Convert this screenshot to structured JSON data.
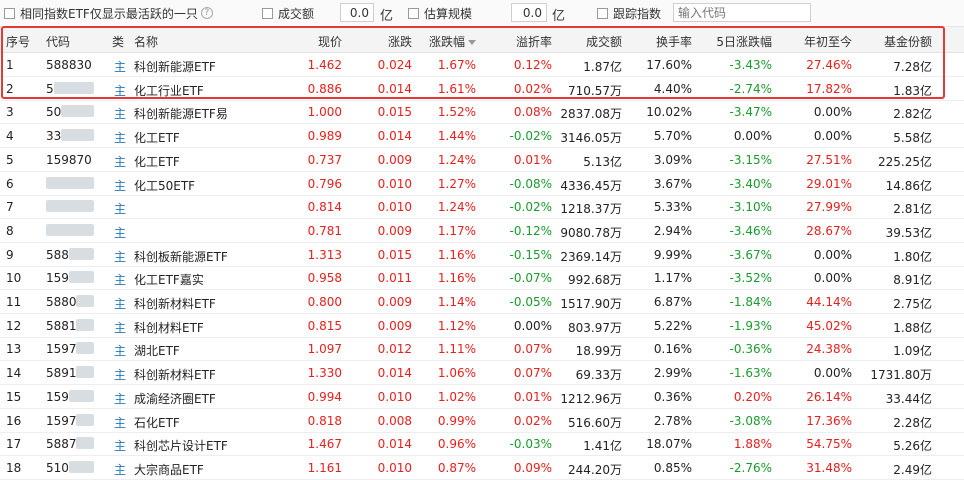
{
  "toolbar": {
    "same_index_label": "相同指数ETF仅显示最活跃的一只",
    "volume_label": "成交额",
    "volume_value": "0.0",
    "volume_unit": "亿",
    "scale_label": "估算规模",
    "scale_value": "0.0",
    "scale_unit": "亿",
    "track_label": "跟踪指数",
    "code_placeholder": "输入代码"
  },
  "columns": [
    "序号",
    "代码",
    "类",
    "名称",
    "现价",
    "涨跌",
    "涨跌幅",
    "溢折率",
    "成交额",
    "换手率",
    "5日涨跌幅",
    "年初至今",
    "基金份额"
  ],
  "type_marker": "主",
  "rows": [
    {
      "idx": "1",
      "code": "588830",
      "name": "科创新能源ETF",
      "price": "1.462",
      "chg": "0.024",
      "pct": "1.67%",
      "prem": "0.12%",
      "vol": "1.87亿",
      "turn": "17.60%",
      "d5": "-3.43%",
      "ytd": "27.46%",
      "shares": "7.28亿"
    },
    {
      "idx": "2",
      "code": "5",
      "name": "化工行业ETF",
      "price": "0.886",
      "chg": "0.014",
      "pct": "1.61%",
      "prem": "0.02%",
      "vol": "710.57万",
      "turn": "4.40%",
      "d5": "-2.74%",
      "ytd": "17.82%",
      "shares": "1.83亿"
    },
    {
      "idx": "3",
      "code": "50",
      "name": "科创新能源ETF易",
      "price": "1.000",
      "chg": "0.015",
      "pct": "1.52%",
      "prem": "0.08%",
      "vol": "2837.08万",
      "turn": "10.02%",
      "d5": "-3.47%",
      "ytd": "0.00%",
      "shares": "2.82亿"
    },
    {
      "idx": "4",
      "code": "33",
      "name": "化工ETF",
      "price": "0.989",
      "chg": "0.014",
      "pct": "1.44%",
      "prem": "-0.02%",
      "vol": "3146.05万",
      "turn": "5.70%",
      "d5": "0.00%",
      "ytd": "0.00%",
      "shares": "5.58亿"
    },
    {
      "idx": "5",
      "code": "159870",
      "name": "化工ETF",
      "price": "0.737",
      "chg": "0.009",
      "pct": "1.24%",
      "prem": "0.01%",
      "vol": "5.13亿",
      "turn": "3.09%",
      "d5": "-3.15%",
      "ytd": "27.51%",
      "shares": "225.25亿"
    },
    {
      "idx": "6",
      "code": "",
      "name": "化工50ETF",
      "price": "0.796",
      "chg": "0.010",
      "pct": "1.27%",
      "prem": "-0.08%",
      "vol": "4336.45万",
      "turn": "3.67%",
      "d5": "-3.40%",
      "ytd": "29.01%",
      "shares": "14.86亿"
    },
    {
      "idx": "7",
      "code": "",
      "name": "",
      "price": "0.814",
      "chg": "0.010",
      "pct": "1.24%",
      "prem": "-0.02%",
      "vol": "1218.37万",
      "turn": "5.33%",
      "d5": "-3.10%",
      "ytd": "27.99%",
      "shares": "2.81亿"
    },
    {
      "idx": "8",
      "code": "",
      "name": "",
      "price": "0.781",
      "chg": "0.009",
      "pct": "1.17%",
      "prem": "-0.12%",
      "vol": "9080.78万",
      "turn": "2.94%",
      "d5": "-3.46%",
      "ytd": "28.67%",
      "shares": "39.53亿"
    },
    {
      "idx": "9",
      "code": "588",
      "name": "科创板新能源ETF",
      "price": "1.313",
      "chg": "0.015",
      "pct": "1.16%",
      "prem": "-0.15%",
      "vol": "2369.14万",
      "turn": "9.99%",
      "d5": "-3.67%",
      "ytd": "0.00%",
      "shares": "1.80亿"
    },
    {
      "idx": "10",
      "code": "159",
      "name": "化工ETF嘉实",
      "price": "0.958",
      "chg": "0.011",
      "pct": "1.16%",
      "prem": "-0.07%",
      "vol": "992.68万",
      "turn": "1.17%",
      "d5": "-3.52%",
      "ytd": "0.00%",
      "shares": "8.91亿"
    },
    {
      "idx": "11",
      "code": "5880",
      "name": "科创新材料ETF",
      "price": "0.800",
      "chg": "0.009",
      "pct": "1.14%",
      "prem": "-0.05%",
      "vol": "1517.90万",
      "turn": "6.87%",
      "d5": "-1.84%",
      "ytd": "44.14%",
      "shares": "2.75亿"
    },
    {
      "idx": "12",
      "code": "5881",
      "name": "科创材料ETF",
      "price": "0.815",
      "chg": "0.009",
      "pct": "1.12%",
      "prem": "0.00%",
      "vol": "803.97万",
      "turn": "5.22%",
      "d5": "-1.93%",
      "ytd": "45.02%",
      "shares": "1.88亿"
    },
    {
      "idx": "13",
      "code": "1597",
      "name": "湖北ETF",
      "price": "1.097",
      "chg": "0.012",
      "pct": "1.11%",
      "prem": "0.07%",
      "vol": "18.99万",
      "turn": "0.16%",
      "d5": "-0.36%",
      "ytd": "24.38%",
      "shares": "1.09亿"
    },
    {
      "idx": "14",
      "code": "5891",
      "name": "科创新材料ETF",
      "price": "1.330",
      "chg": "0.014",
      "pct": "1.06%",
      "prem": "0.07%",
      "vol": "69.33万",
      "turn": "2.99%",
      "d5": "-1.63%",
      "ytd": "0.00%",
      "shares": "1731.80万"
    },
    {
      "idx": "15",
      "code": "159",
      "name": "成渝经济圈ETF",
      "price": "0.994",
      "chg": "0.010",
      "pct": "1.02%",
      "prem": "0.01%",
      "vol": "1212.96万",
      "turn": "0.36%",
      "d5": "0.20%",
      "ytd": "26.14%",
      "shares": "33.44亿"
    },
    {
      "idx": "16",
      "code": "1597",
      "name": "石化ETF",
      "price": "0.818",
      "chg": "0.008",
      "pct": "0.99%",
      "prem": "0.02%",
      "vol": "516.60万",
      "turn": "2.78%",
      "d5": "-3.08%",
      "ytd": "17.36%",
      "shares": "2.28亿"
    },
    {
      "idx": "17",
      "code": "5887",
      "name": "科创芯片设计ETF",
      "price": "1.467",
      "chg": "0.014",
      "pct": "0.96%",
      "prem": "-0.03%",
      "vol": "1.41亿",
      "turn": "18.07%",
      "d5": "1.88%",
      "ytd": "54.75%",
      "shares": "5.26亿"
    },
    {
      "idx": "18",
      "code": "510",
      "name": "大宗商品ETF",
      "price": "1.161",
      "chg": "0.010",
      "pct": "0.87%",
      "prem": "0.09%",
      "vol": "244.20万",
      "turn": "0.85%",
      "d5": "-2.76%",
      "ytd": "31.48%",
      "shares": "2.49亿"
    }
  ],
  "colors": {
    "up": "#e8201d",
    "down": "#1b9b2e",
    "highlight": "#e53935"
  }
}
